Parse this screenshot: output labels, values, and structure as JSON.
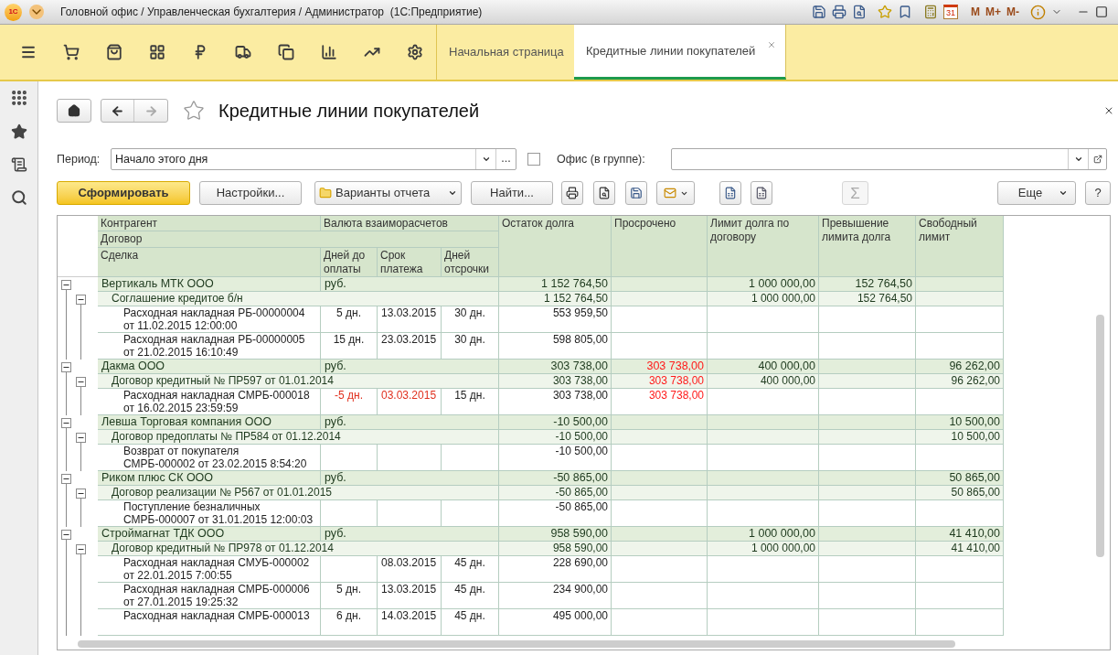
{
  "window": {
    "logo": "1С",
    "title": "Головной офис / Управленческая бухгалтерия / Администратор  (1С:Предприятие)",
    "calendar_day": "31",
    "memory_buttons": [
      "M",
      "M+",
      "M-"
    ]
  },
  "tabs": [
    {
      "label": "Начальная страница",
      "selected": false
    },
    {
      "label": "Кредитные линии покупателей",
      "selected": true
    }
  ],
  "page": {
    "title": "Кредитные линии покупателей"
  },
  "filters": {
    "period_label": "Период:",
    "period_value": "Начало этого дня",
    "period_more": "...",
    "office_label": "Офис (в группе):",
    "office_checked": false
  },
  "actions": {
    "generate": "Сформировать",
    "settings": "Настройки...",
    "variants": "Варианты отчета",
    "find": "Найти...",
    "sum": "Σ",
    "sum_disabled": true,
    "more": "Еще",
    "help": "?"
  },
  "header": {
    "counterparty": "Контрагент",
    "currency": "Валюта взаиморасчетов",
    "contract": "Договор",
    "deal": "Сделка",
    "days_to_pay": "Дней до оплаты",
    "due_date": "Срок платежа",
    "deferral": "Дней отсрочки",
    "balance": "Остаток долга",
    "overdue": "Просрочено",
    "limit": "Лимит долга по договору",
    "excess": "Превышение лимита долга",
    "free": "Свободный лимит"
  },
  "groups": [
    {
      "name": "Вертикаль МТК ООО",
      "currency": "руб.",
      "balance": "1 152 764,50",
      "limit": "1 000 000,00",
      "excess": "152 764,50",
      "expanded": true,
      "children": [
        {
          "name": "Соглашение кредитое б/н",
          "balance": "1 152 764,50",
          "limit": "1 000 000,00",
          "excess": "152 764,50",
          "expanded": true,
          "children": [
            {
              "name": "Расходная накладная РБ-00000004\nот 11.02.2015 12:00:00",
              "days": "5 дн.",
              "due": "13.03.2015",
              "deferral": "30 дн.",
              "balance": "553 959,50",
              "overdue_flag": false
            },
            {
              "name": "Расходная накладная РБ-00000005\nот 21.02.2015 16:10:49",
              "days": "15 дн.",
              "due": "23.03.2015",
              "deferral": "30 дн.",
              "balance": "598 805,00",
              "overdue_flag": false
            }
          ]
        }
      ]
    },
    {
      "name": "Дакма ООО",
      "currency": "руб.",
      "balance": "303 738,00",
      "overdue": "303 738,00",
      "limit": "400 000,00",
      "free": "96 262,00",
      "expanded": true,
      "children": [
        {
          "name": "Договор кредитный № ПР597 от 01.01.2014",
          "balance": "303 738,00",
          "overdue": "303 738,00",
          "limit": "400 000,00",
          "free": "96 262,00",
          "expanded": true,
          "children": [
            {
              "name": "Расходная накладная СМРБ-000018\nот 16.02.2015 23:59:59",
              "days": "-5 дн.",
              "due": "03.03.2015",
              "deferral": "15 дн.",
              "balance": "303 738,00",
              "overdue": "303 738,00",
              "overdue_flag": true
            }
          ]
        }
      ]
    },
    {
      "name": "Левша Торговая компания ООО",
      "currency": "руб.",
      "balance": "-10 500,00",
      "free": "10 500,00",
      "expanded": true,
      "children": [
        {
          "name": "Договор предоплаты № ПР584 от 01.12.2014",
          "balance": "-10 500,00",
          "free": "10 500,00",
          "expanded": true,
          "children": [
            {
              "name": "Возврат от покупателя\nСМРБ-000002 от 23.02.2015 8:54:20",
              "balance": "-10 500,00",
              "overdue_flag": false
            }
          ]
        }
      ]
    },
    {
      "name": "Риком плюс СК ООО",
      "currency": "руб.",
      "balance": "-50 865,00",
      "free": "50 865,00",
      "expanded": true,
      "children": [
        {
          "name": "Договор реализации № Р567 от 01.01.2015",
          "balance": "-50 865,00",
          "free": "50 865,00",
          "expanded": true,
          "children": [
            {
              "name": "Поступление безналичных\nСМРБ-000007 от 31.01.2015 12:00:03",
              "balance": "-50 865,00",
              "overdue_flag": false
            }
          ]
        }
      ]
    },
    {
      "name": "Строймагнат ТДК ООО",
      "currency": "руб.",
      "balance": "958 590,00",
      "limit": "1 000 000,00",
      "free": "41 410,00",
      "expanded": true,
      "children": [
        {
          "name": "Договор кредитный № ПР978 от 01.12.2014",
          "balance": "958 590,00",
          "limit": "1 000 000,00",
          "free": "41 410,00",
          "expanded": true,
          "children": [
            {
              "name": "Расходная накладная СМУБ-000002\nот 22.01.2015 7:00:55",
              "due": "08.03.2015",
              "deferral": "45 дн.",
              "balance": "228 690,00",
              "overdue_flag": false
            },
            {
              "name": "Расходная накладная СМРБ-000006\nот 27.01.2015 19:25:32",
              "days": "5 дн.",
              "due": "13.03.2015",
              "deferral": "45 дн.",
              "balance": "234 900,00",
              "overdue_flag": false
            },
            {
              "name": "Расходная накладная СМРБ-000013",
              "days": "6 дн.",
              "due": "14.03.2015",
              "deferral": "45 дн.",
              "balance": "495 000,00",
              "overdue_flag": false
            }
          ]
        }
      ]
    }
  ]
}
